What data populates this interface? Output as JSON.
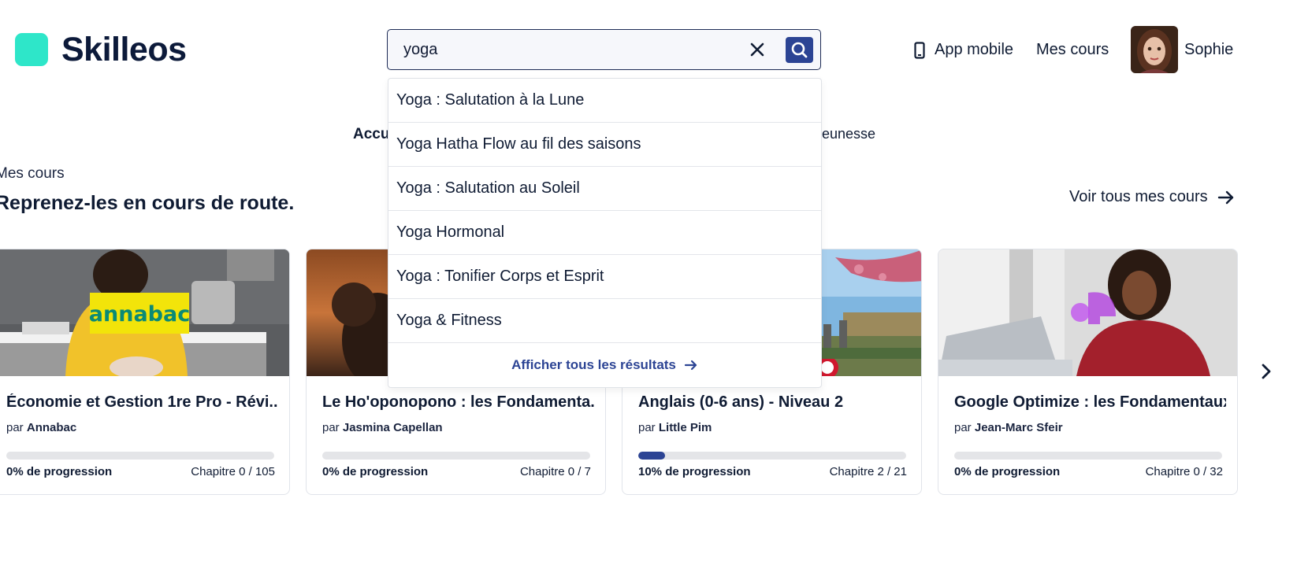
{
  "header": {
    "logo_text": "Skilleos",
    "search": {
      "value": "yoga",
      "placeholder": ""
    },
    "app_mobile_label": "App mobile",
    "my_courses_label": "Mes cours",
    "user_name": "Sophie"
  },
  "subnav": {
    "left_label": "Accu",
    "right_label": "eunesse"
  },
  "section": {
    "label": "Mes cours",
    "title": "Reprenez-les en cours de route.",
    "see_all_label": "Voir tous mes cours"
  },
  "courses": [
    {
      "title": "Économie et Gestion 1re Pro - Révi...",
      "by": "par",
      "author": "Annabac",
      "progress_label": "0% de progression",
      "progress": 0,
      "chapter_label": "Chapitre 0 / 105",
      "image_brand": "annabac"
    },
    {
      "title": "Le Ho'oponopono : les Fondamenta...",
      "by": "par",
      "author": "Jasmina Capellan",
      "progress_label": "0% de progression",
      "progress": 0,
      "chapter_label": "Chapitre 0 / 7"
    },
    {
      "title": "Anglais (0-6 ans) - Niveau 2",
      "by": "par",
      "author": "Little Pim",
      "progress_label": "10% de progression",
      "progress": 10,
      "chapter_label": "Chapitre 2 / 21"
    },
    {
      "title": "Google Optimize : les Fondamentaux",
      "by": "par",
      "author": "Jean-Marc Sfeir",
      "progress_label": "0% de progression",
      "progress": 0,
      "chapter_label": "Chapitre 0 / 32"
    }
  ],
  "suggestions": {
    "items": [
      "Yoga : Salutation à la Lune",
      "Yoga Hatha Flow au fil des saisons",
      "Yoga : Salutation au Soleil",
      "Yoga Hormonal",
      "Yoga : Tonifier Corps et Esprit",
      "Yoga & Fitness"
    ],
    "show_all_label": "Afficher tous les résultats"
  },
  "colors": {
    "brand_teal": "#2ee6c9",
    "primary_blue": "#2c4494",
    "text_dark": "#0f1b33"
  }
}
